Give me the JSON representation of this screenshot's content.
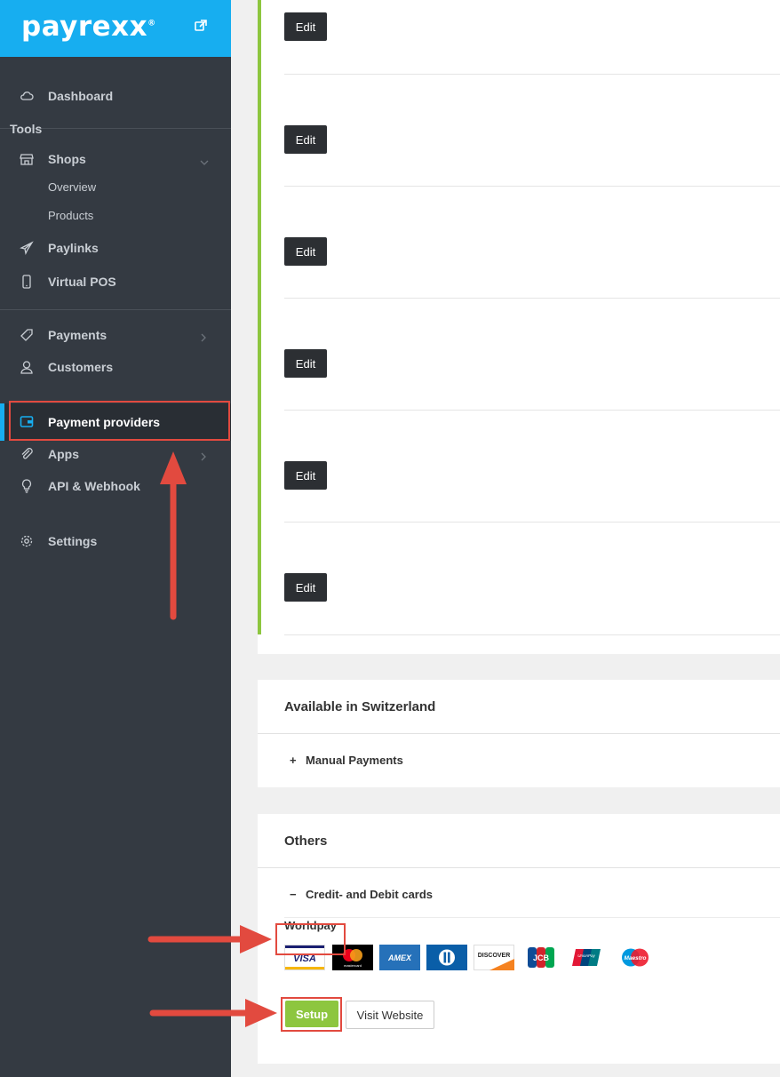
{
  "sidebar": {
    "logo": "payrexx",
    "logo_mark": "®",
    "section_tools": "Tools",
    "items": [
      {
        "label": "Dashboard",
        "icon": "cloud-icon"
      },
      {
        "label": "Shops",
        "icon": "store-icon"
      },
      {
        "label": "Overview"
      },
      {
        "label": "Products"
      },
      {
        "label": "Paylinks",
        "icon": "paper-plane-icon"
      },
      {
        "label": "Virtual POS",
        "icon": "mobile-icon"
      },
      {
        "label": "Payments",
        "icon": "tag-icon"
      },
      {
        "label": "Customers",
        "icon": "user-icon"
      },
      {
        "label": "Payment providers",
        "icon": "wallet-icon",
        "active": true
      },
      {
        "label": "Apps",
        "icon": "paperclip-icon"
      },
      {
        "label": "API & Webhook",
        "icon": "lightbulb-icon"
      },
      {
        "label": "Settings",
        "icon": "gear-icon"
      }
    ]
  },
  "main": {
    "edit_label": "Edit",
    "edit_rows": 6,
    "switzerland": {
      "title": "Available in Switzerland",
      "toggle": "Manual Payments",
      "toggle_sign": "+"
    },
    "others": {
      "title": "Others",
      "toggle": "Credit- and Debit cards",
      "toggle_sign": "−",
      "provider": "Worldpay",
      "cards": [
        {
          "name": "visa-card-icon",
          "text": "VISA"
        },
        {
          "name": "mastercard-card-icon",
          "text": "mastercard"
        },
        {
          "name": "amex-card-icon",
          "text": "AMEX"
        },
        {
          "name": "diners-card-icon",
          "text": ""
        },
        {
          "name": "discover-card-icon",
          "text": "DISCOVER"
        },
        {
          "name": "jcb-card-icon",
          "text": "JCB"
        },
        {
          "name": "unionpay-card-icon",
          "text": "UnionPay"
        },
        {
          "name": "maestro-card-icon",
          "text": "Maestro"
        }
      ],
      "setup_label": "Setup",
      "visit_label": "Visit Website"
    }
  },
  "colors": {
    "brand": "#17aef0",
    "sidebar": "#343a42",
    "accent_green": "#8dc63f",
    "annotation_red": "#e24a3f"
  }
}
